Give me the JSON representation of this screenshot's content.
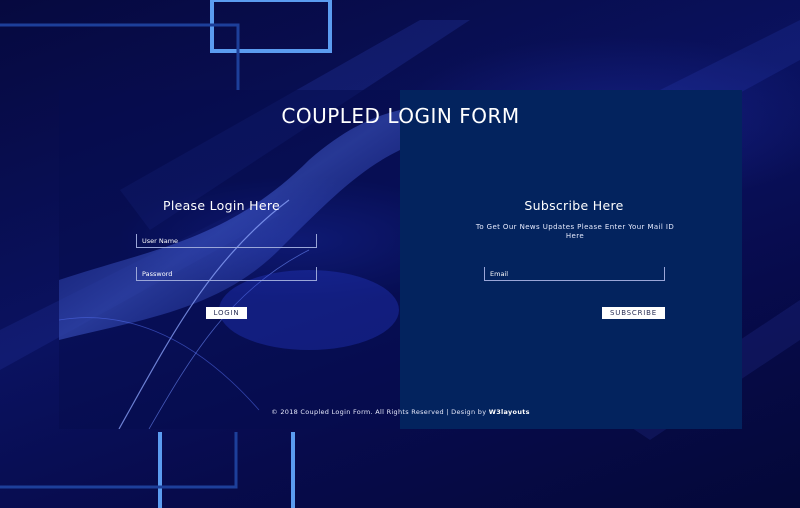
{
  "header": {
    "title": "COUPLED LOGIN FORM"
  },
  "login": {
    "heading": "Please Login Here",
    "username_placeholder": "User Name",
    "password_placeholder": "Password",
    "button_label": "LOGIN"
  },
  "subscribe": {
    "heading": "Subscribe  Here",
    "note": "To Get Our News Updates Please Enter Your Mail ID Here",
    "email_placeholder": "Email",
    "button_label": "SUBSCRIBE"
  },
  "footer": {
    "copyright": "© 2018 Coupled Login Form. All Rights Reserved | Design by ",
    "designer": "W3layouts"
  },
  "colors": {
    "background": "#050a45",
    "right_panel": "#03235e",
    "frame_accent": "#5b9cf0",
    "text": "#ffffff"
  }
}
